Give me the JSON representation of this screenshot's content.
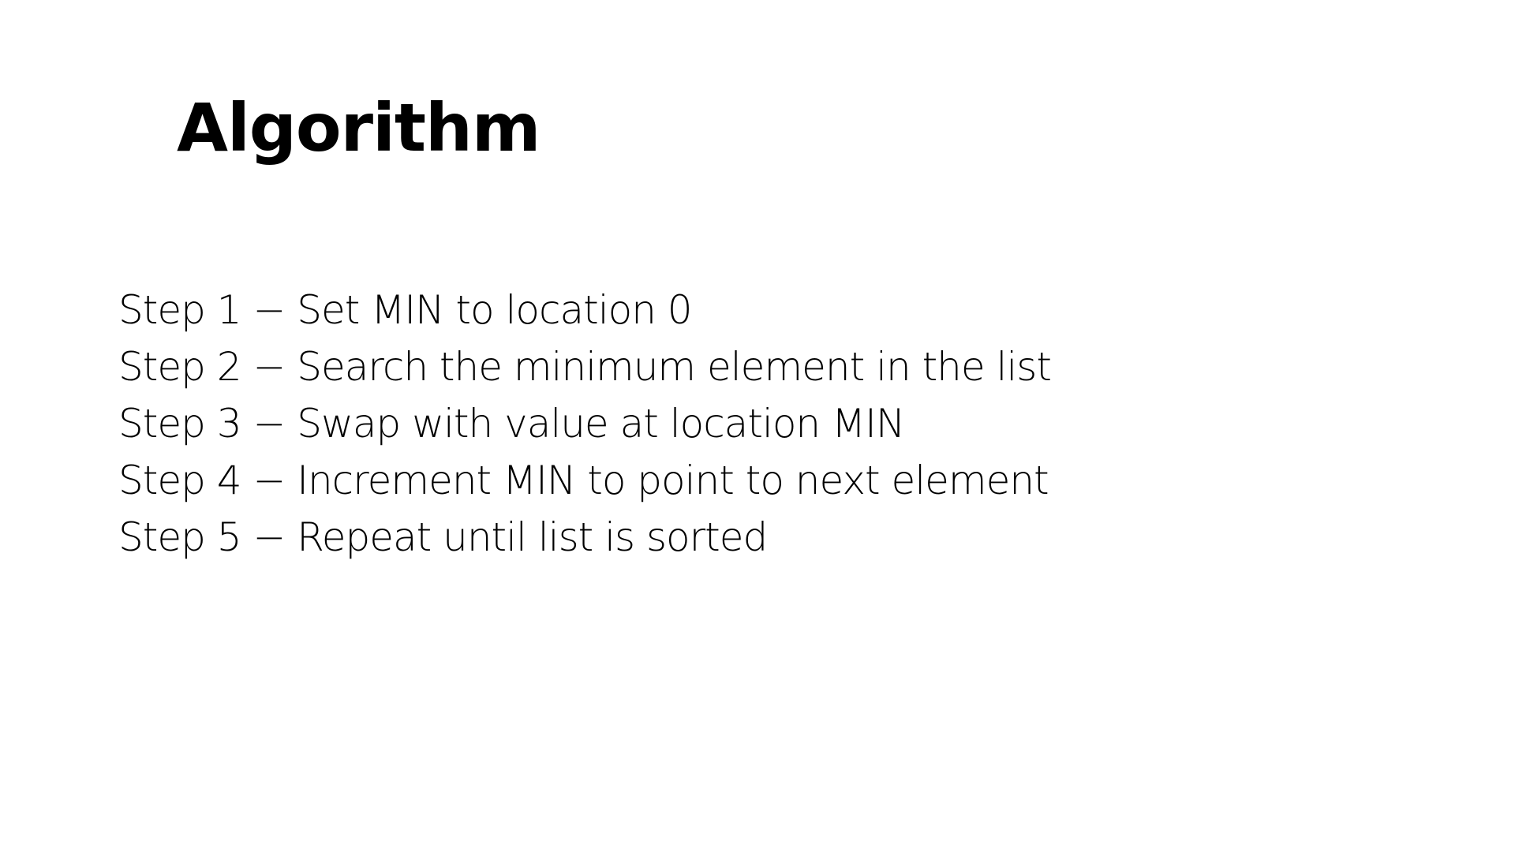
{
  "slide": {
    "title": "Algorithm",
    "steps": [
      "Step 1 − Set MIN to location 0",
      "Step 2 − Search the minimum element in the list",
      "Step 3 − Swap with value at location MIN",
      "Step 4 − Increment MIN to point to next element",
      "Step 5 − Repeat until list is sorted"
    ]
  },
  "colors": {
    "background": "#ffffff",
    "text": "#000000"
  }
}
